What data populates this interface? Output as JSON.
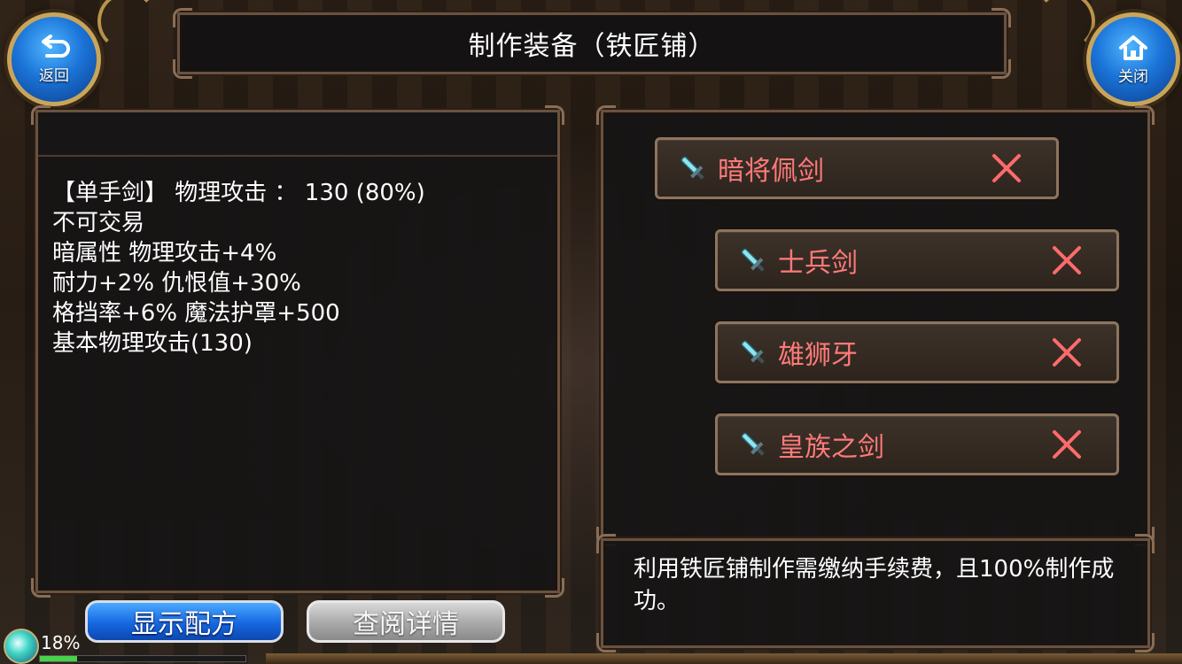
{
  "header": {
    "title": "制作装备（铁匠铺）",
    "back_label": "返回",
    "close_label": "关闭"
  },
  "info_panel": {
    "lines": [
      "【单手剑】 物理攻击 ：  130 (80%)",
      "不可交易",
      "暗属性 物理攻击+4%",
      "耐力+2% 仇恨值+30%",
      "格挡率+6% 魔法护罩+500",
      "基本物理攻击(130)"
    ]
  },
  "recipe_list": {
    "items": [
      {
        "name": "暗将佩剑",
        "icon": "sword-icon",
        "status_icon": "x-icon"
      },
      {
        "name": "士兵剑",
        "icon": "sword-icon",
        "status_icon": "x-icon"
      },
      {
        "name": "雄狮牙",
        "icon": "sword-icon",
        "status_icon": "x-icon"
      },
      {
        "name": "皇族之剑",
        "icon": "sword-icon",
        "status_icon": "x-icon"
      }
    ]
  },
  "description": {
    "text": "利用铁匠铺制作需缴纳手续费，且100%制作成功。"
  },
  "buttons": {
    "show_recipe": "显示配方",
    "view_detail": "查阅详情"
  },
  "status": {
    "percent_label": "18%",
    "progress": 0.18
  },
  "colors": {
    "item_name": "#ff7a7a",
    "x_mark": "#ff6b6b",
    "accent_blue": "#1b74d8",
    "progress": "#48d14b"
  }
}
